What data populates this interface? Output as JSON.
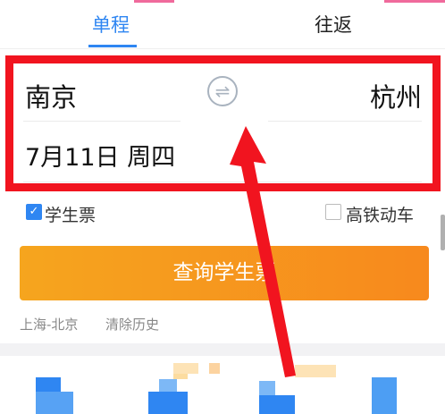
{
  "tabs": {
    "oneway": "单程",
    "roundtrip": "往返"
  },
  "route": {
    "from": "南京",
    "to": "杭州"
  },
  "date": "7月11日 周四",
  "options": {
    "student": "学生票",
    "student_checked": "✓",
    "high_speed": "高铁动车"
  },
  "query_button": "查询学生票",
  "history": {
    "item": "上海-北京",
    "clear": "清除历史"
  },
  "icons": {
    "swap": "swap-icon",
    "check": "checkbox-checked-icon"
  },
  "colors": {
    "accent": "#2f86f2",
    "highlight": "#f1141f",
    "button": "#f7891d",
    "arrow": "#f1141f"
  }
}
